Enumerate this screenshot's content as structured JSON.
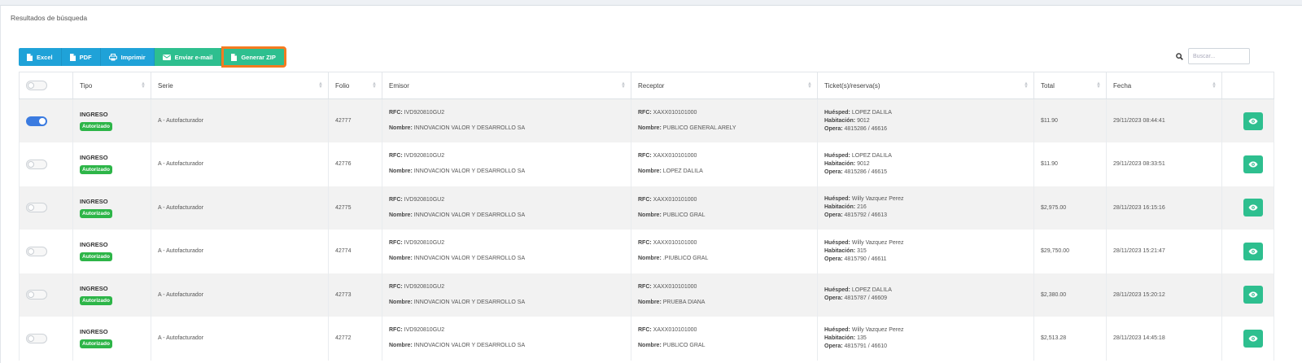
{
  "panel": {
    "title": "Resultados de búsqueda"
  },
  "toolbar": {
    "excel_label": "Excel",
    "pdf_label": "PDF",
    "print_label": "Imprimir",
    "email_label": "Enviar e-mail",
    "zip_label": "Generar ZIP"
  },
  "search": {
    "placeholder": "Buscar..."
  },
  "columns": {
    "tipo": "Tipo",
    "serie": "Serie",
    "folio": "Folio",
    "emisor": "Emisor",
    "receptor": "Receptor",
    "ticket": "Ticket(s)/reserva(s)",
    "total": "Total",
    "fecha": "Fecha"
  },
  "labels": {
    "rfc": "RFC:",
    "nombre": "Nombre:",
    "huesped": "Huésped:",
    "habitacion": "Habitación:",
    "opera": "Opera:"
  },
  "colors": {
    "primary": "#1fa2d8",
    "success": "#2ebf8f",
    "badge": "#2db548",
    "highlight": "#f47b20",
    "toggle_on": "#3b7be0"
  },
  "rows": [
    {
      "selected": true,
      "tipo": "INGRESO",
      "estado": "Autorizado",
      "serie": "A - Autofacturador",
      "folio": "42777",
      "emisor_rfc": "IVD920810GU2",
      "emisor_nombre": "INNOVACION VALOR Y DESARROLLO SA",
      "receptor_rfc": "XAXX010101000",
      "receptor_nombre": "PUBLICO GENERAL ARELY",
      "huesped": "LOPEZ DALILA",
      "habitacion": "9012",
      "opera": "4815286 / 46616",
      "total": "$11.90",
      "fecha": "29/11/2023 08:44:41"
    },
    {
      "selected": false,
      "tipo": "INGRESO",
      "estado": "Autorizado",
      "serie": "A - Autofacturador",
      "folio": "42776",
      "emisor_rfc": "IVD920810GU2",
      "emisor_nombre": "INNOVACION VALOR Y DESARROLLO SA",
      "receptor_rfc": "XAXX010101000",
      "receptor_nombre": "LOPEZ DALILA",
      "huesped": "LOPEZ DALILA",
      "habitacion": "9012",
      "opera": "4815286 / 46615",
      "total": "$11.90",
      "fecha": "29/11/2023 08:33:51"
    },
    {
      "selected": false,
      "tipo": "INGRESO",
      "estado": "Autorizado",
      "serie": "A - Autofacturador",
      "folio": "42775",
      "emisor_rfc": "IVD920810GU2",
      "emisor_nombre": "INNOVACION VALOR Y DESARROLLO SA",
      "receptor_rfc": "XAXX010101000",
      "receptor_nombre": "PUBLICO GRAL",
      "huesped": "Willy Vazquez Perez",
      "habitacion": "216",
      "opera": "4815792 / 46613",
      "total": "$2,975.00",
      "fecha": "28/11/2023 16:15:16"
    },
    {
      "selected": false,
      "tipo": "INGRESO",
      "estado": "Autorizado",
      "serie": "A - Autofacturador",
      "folio": "42774",
      "emisor_rfc": "IVD920810GU2",
      "emisor_nombre": "INNOVACION VALOR Y DESARROLLO SA",
      "receptor_rfc": "XAXX010101000",
      "receptor_nombre": ".PIUBLICO GRAL",
      "huesped": "Willy Vazquez Perez",
      "habitacion": "315",
      "opera": "4815790 / 46611",
      "total": "$29,750.00",
      "fecha": "28/11/2023 15:21:47"
    },
    {
      "selected": false,
      "tipo": "INGRESO",
      "estado": "Autorizado",
      "serie": "A - Autofacturador",
      "folio": "42773",
      "emisor_rfc": "IVD920810GU2",
      "emisor_nombre": "INNOVACION VALOR Y DESARROLLO SA",
      "receptor_rfc": "XAXX010101000",
      "receptor_nombre": "PRUEBA DIANA",
      "huesped": "LOPEZ DALILA",
      "habitacion": null,
      "opera": "4815787 / 46609",
      "total": "$2,380.00",
      "fecha": "28/11/2023 15:20:12"
    },
    {
      "selected": false,
      "tipo": "INGRESO",
      "estado": "Autorizado",
      "serie": "A - Autofacturador",
      "folio": "42772",
      "emisor_rfc": "IVD920810GU2",
      "emisor_nombre": "INNOVACION VALOR Y DESARROLLO SA",
      "receptor_rfc": "XAXX010101000",
      "receptor_nombre": "PUBLICO GRAL",
      "huesped": "Willy Vazquez Perez",
      "habitacion": "135",
      "opera": "4815791 / 46610",
      "total": "$2,513.28",
      "fecha": "28/11/2023 14:45:18"
    }
  ]
}
